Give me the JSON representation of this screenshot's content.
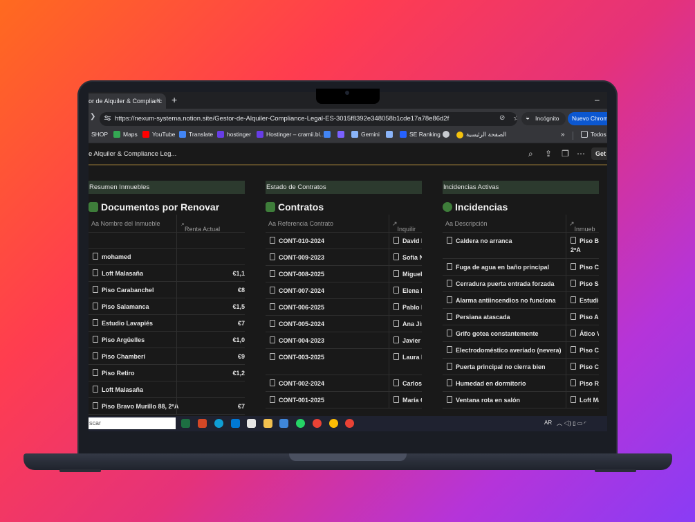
{
  "browser": {
    "tab_title": "or de Alquiler & Complianc",
    "tab_close": "×",
    "new_tab": "+",
    "minimize": "–",
    "url": "https://nexum-systema.notion.site/Gestor-de-Alquiler-Compliance-Legal-ES-3015f8392e348058b1cde17a78e86d2f",
    "incognito_label": "Incógnito",
    "new_chrome_label": "Nuevo Chrome",
    "bookmarks": [
      {
        "label": "SHOP",
        "color": "#4a4a4a"
      },
      {
        "label": "Maps",
        "color": "#34a853"
      },
      {
        "label": "YouTube",
        "color": "#ff0000"
      },
      {
        "label": "Translate",
        "color": "#4285f4"
      },
      {
        "label": "hostinger",
        "color": "#673de6"
      },
      {
        "label": "Hostinger – cramii.bl...",
        "color": "#673de6"
      },
      {
        "label": "",
        "color": "#4285f4"
      },
      {
        "label": "",
        "color": "#7b61ff"
      },
      {
        "label": "Gemini",
        "color": "#8ab4f8"
      },
      {
        "label": "",
        "color": "#8ab4f8"
      },
      {
        "label": "SE Ranking",
        "color": "#2662ff"
      },
      {
        "label": "",
        "color": "#c8cbd0"
      },
      {
        "label": "الصفحة الرئيسية",
        "color": "#f4c20d"
      }
    ],
    "bookmarks_more": "»",
    "all_bookmarks": "Todos"
  },
  "notion": {
    "page_title": "e Alquiler & Compliance Leg...",
    "get_button": "Get"
  },
  "columns": [
    {
      "header": "Resumen Inmuebles",
      "db_title": "Documentos por Renovar",
      "db_icon_color": "#4caf50",
      "prop1": "Aa  Nombre del Inmueble",
      "prop2": "Renta Actual",
      "rows": [
        {
          "name": "",
          "value": ""
        },
        {
          "name": "mohamed",
          "value": ""
        },
        {
          "name": "Loft Malasaña",
          "value": "€1,1"
        },
        {
          "name": "Piso Carabanchel",
          "value": "€8"
        },
        {
          "name": "Piso Salamanca",
          "value": "€1,5"
        },
        {
          "name": "Estudio Lavapiés",
          "value": "€7"
        },
        {
          "name": "Piso Argüelles",
          "value": "€1,0"
        },
        {
          "name": "Piso Chamberí",
          "value": "€9"
        },
        {
          "name": "Piso Retiro",
          "value": "€1,2"
        },
        {
          "name": "Loft Malasaña",
          "value": ""
        },
        {
          "name": "Piso Bravo Murillo 88, 2ºA",
          "value": "€7"
        }
      ]
    },
    {
      "header": "Estado de Contratos",
      "db_title": "Contratos",
      "db_icon_color": "#4caf50",
      "prop1": "Aa  Referencia Contrato",
      "prop2": "Inquilir",
      "rows": [
        {
          "name": "CONT-010-2024",
          "value": "David I"
        },
        {
          "name": "CONT-009-2023",
          "value": "Sofía N"
        },
        {
          "name": "CONT-008-2025",
          "value": "Miguel"
        },
        {
          "name": "CONT-007-2024",
          "value": "Elena D"
        },
        {
          "name": "CONT-006-2025",
          "value": "Pablo I"
        },
        {
          "name": "CONT-005-2024",
          "value": "Ana Jir"
        },
        {
          "name": "CONT-004-2023",
          "value": "Javier I"
        },
        {
          "name": "CONT-003-2025",
          "value": "Laura I"
        },
        {
          "name": "CONT-002-2024",
          "value": "Carlos"
        },
        {
          "name": "CONT-001-2025",
          "value": "María C"
        }
      ]
    },
    {
      "header": "Incidencias Activas",
      "db_title": "Incidencias",
      "db_icon_color": "#4caf50",
      "prop1": "Aa  Descripción",
      "prop2": "Inmueb",
      "rows": [
        {
          "name": "Caldera no arranca",
          "value": "Piso Br",
          "value2": "2ºA"
        },
        {
          "name": "Fuga de agua en baño principal",
          "value": "Piso Ca"
        },
        {
          "name": "Cerradura puerta entrada forzada",
          "value": "Piso Sa"
        },
        {
          "name": "Alarma antiincendios no funciona",
          "value": "Estudic"
        },
        {
          "name": "Persiana atascada",
          "value": "Piso Ar"
        },
        {
          "name": "Grifo gotea constantemente",
          "value": "Ático V"
        },
        {
          "name": "Electrodoméstico averiado (nevera)",
          "value": "Piso Ca"
        },
        {
          "name": "Puerta principal no cierra bien",
          "value": "Piso Ch"
        },
        {
          "name": "Humedad en dormitorio",
          "value": "Piso Re"
        },
        {
          "name": "Ventana rota en salón",
          "value": "Loft Ma"
        }
      ]
    }
  ],
  "taskbar": {
    "search_text": "scar",
    "lang": "AR",
    "apps": [
      {
        "name": "excel-icon",
        "color": "#1d6f42"
      },
      {
        "name": "powerpoint-icon",
        "color": "#d24726"
      },
      {
        "name": "edge-icon",
        "color": "#0f9ed5"
      },
      {
        "name": "outlook-icon",
        "color": "#0078d4"
      },
      {
        "name": "store-icon",
        "color": "#e5e5e5"
      },
      {
        "name": "folder-icon",
        "color": "#f2c04f"
      },
      {
        "name": "mail-icon",
        "color": "#3f86d9"
      },
      {
        "name": "whatsapp-icon",
        "color": "#25d366"
      },
      {
        "name": "chrome-icon",
        "color": "#e94235"
      },
      {
        "name": "chrome-active-icon",
        "color": "#fbbc04"
      },
      {
        "name": "chrome-alt-icon",
        "color": "#e94235"
      }
    ]
  }
}
